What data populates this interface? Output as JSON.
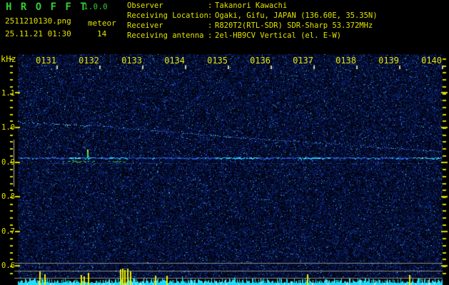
{
  "header": {
    "app_title": "H R O F F T",
    "app_version": "1.0.0",
    "filename": "2511210130.png",
    "datetime": "25.11.21 01:30",
    "meteor_label": "meteor",
    "meteor_count": "14",
    "info": [
      {
        "label": "Observer",
        "colon": ":",
        "value": "Takanori Kawachi"
      },
      {
        "label": "Receiving Location",
        "colon": ":",
        "value": "Ogaki, Gifu, JAPAN (136.60E, 35.35N)"
      },
      {
        "label": "Receiver",
        "colon": ":",
        "value": "R820T2(RTL-SDR) SDR-Sharp 53.372MHz"
      },
      {
        "label": "Receiving antenna",
        "colon": ":",
        "value": "2el-HB9CV Vertical (el. E-W)"
      }
    ]
  },
  "colors": {
    "background": "#000000",
    "text_yellow": "#e2e200",
    "title_green": "#33cc33",
    "tick_yellow": "#d8d800",
    "top_tick": "#d8d890",
    "gray_line": "#8a8a8a",
    "marker_gray": "#b4b4b4",
    "strip_cyan": "#23dcf8",
    "strip_cyan_bright": "#9ef4ff",
    "spike_yellow": "#f0f000"
  },
  "chart_data": {
    "type": "heatmap",
    "subtype": "radio-meteor-spectrogram",
    "title": "",
    "xlabel": "",
    "ylabel": "kHz",
    "x_tick_labels": [
      "0131",
      "0132",
      "0133",
      "0134",
      "0135",
      "0136",
      "0137",
      "0138",
      "0139",
      "0140"
    ],
    "y_tick_values": [
      1.1,
      1.0,
      0.9,
      0.8,
      0.7,
      0.6
    ],
    "y_minor_step_khz": 0.02,
    "time_span_minutes": [
      0,
      10.15
    ],
    "ylim_khz": [
      0.545,
      1.215
    ],
    "grid": false,
    "legend": "none",
    "traces": [
      {
        "name": "drifting-carrier",
        "type": "dotted-line",
        "points_t_khz": [
          [
            0.083,
            1.016
          ],
          [
            1.333,
            1.008
          ],
          [
            2.167,
            1.004
          ],
          [
            3.417,
            0.99
          ],
          [
            4.667,
            0.977
          ],
          [
            6.75,
            0.959
          ],
          [
            8.0,
            0.948
          ],
          [
            10.15,
            0.93
          ]
        ]
      },
      {
        "name": "main-carrier",
        "type": "horizontal-line",
        "khz": 0.911,
        "t_range": [
          0.083,
          9.98
        ],
        "bright_t_ranges": [
          [
            1.25,
            1.87
          ],
          [
            2.2,
            2.63
          ],
          [
            4.67,
            5.67
          ],
          [
            6.67,
            7.37
          ],
          [
            9.25,
            9.95
          ]
        ]
      },
      {
        "name": "carrier-sideband",
        "type": "horizontal-line",
        "khz": 0.896,
        "t_range": [
          0.67,
          9.98
        ]
      },
      {
        "name": "meteor-echo-green",
        "type": "segments",
        "khz": 0.904,
        "t_ranges": [
          [
            1.25,
            1.867
          ],
          [
            2.2,
            2.583
          ]
        ]
      },
      {
        "name": "meteor-echo-tick",
        "type": "vertical-tick",
        "t": 1.717,
        "khz_range": [
          0.912,
          0.936
        ]
      }
    ],
    "meteor_events_t_min": [
      {
        "t": 0.583,
        "h": 18
      },
      {
        "t": 0.7,
        "h": 14
      },
      {
        "t": 1.55,
        "h": 13
      },
      {
        "t": 1.617,
        "h": 11
      },
      {
        "t": 1.717,
        "h": 16
      },
      {
        "t": 2.467,
        "h": 21
      },
      {
        "t": 2.517,
        "h": 22
      },
      {
        "t": 2.567,
        "h": 20
      },
      {
        "t": 2.633,
        "h": 22
      },
      {
        "t": 2.7,
        "h": 18
      },
      {
        "t": 3.283,
        "h": 12
      },
      {
        "t": 3.55,
        "h": 12
      },
      {
        "t": 6.833,
        "h": 14
      },
      {
        "t": 9.217,
        "h": 13
      }
    ],
    "reference_lines": {
      "horizontal_khz": [
        0.608,
        0.586,
        0.565
      ],
      "vertical_marker": {
        "t": -0.017,
        "khz_range": [
          0.829,
          0.965
        ]
      }
    },
    "activity_strip": {
      "position": "bottom",
      "bar_color": "cyan",
      "spike_color": "yellow"
    }
  }
}
